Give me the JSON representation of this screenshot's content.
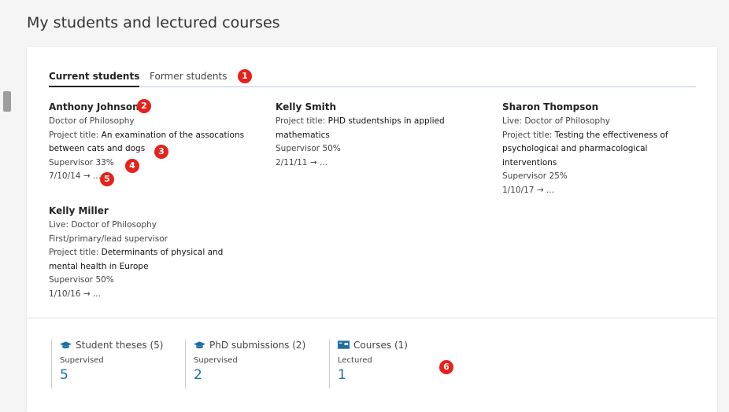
{
  "page": {
    "title": "My students and lectured courses"
  },
  "tabs": {
    "current": "Current students",
    "former": "Former students"
  },
  "students": [
    {
      "name": "Anthony Johnson",
      "degree": "Doctor of Philosophy",
      "project_key": "Project title: ",
      "project_line1": "An examination of the assocations",
      "project_line2": "between cats and dogs",
      "supervisor": "Supervisor 33%",
      "date": "7/10/14 → ..."
    },
    {
      "name": "Kelly Smith",
      "project_key": "Project title: ",
      "project_line1": "PHD studentships in applied",
      "project_line2": "mathematics",
      "supervisor": "Supervisor 50%",
      "date": "2/11/11 → ..."
    },
    {
      "name": "Sharon Thompson",
      "degree": "Live: Doctor of Philosophy",
      "project_key": "Project title: ",
      "project_line1": "Testing the effectiveness of",
      "project_line2": "psychological and pharmacological",
      "project_line3": "interventions",
      "supervisor": "Supervisor 25%",
      "date": "1/10/17 → ..."
    },
    {
      "name": "Kelly Miller",
      "degree": "Live: Doctor of Philosophy",
      "role": "First/primary/lead supervisor",
      "project_key": "Project title: ",
      "project_line1": "Determinants of physical and",
      "project_line2": "mental health in Europe",
      "supervisor": "Supervisor 50%",
      "date": "1/10/16 → ..."
    }
  ],
  "stats": [
    {
      "label": "Student theses (5)",
      "sub": "Supervised",
      "value": "5",
      "icon": "graduation-cap-icon"
    },
    {
      "label": "PhD submissions (2)",
      "sub": "Supervised",
      "value": "2",
      "icon": "graduation-cap-icon"
    },
    {
      "label": "Courses (1)",
      "sub": "Lectured",
      "value": "1",
      "icon": "presentation-board-icon"
    }
  ],
  "markers": [
    "1",
    "2",
    "3",
    "4",
    "5",
    "6"
  ],
  "colors": {
    "accent": "#1d6fa5",
    "marker": "#e8211b"
  }
}
